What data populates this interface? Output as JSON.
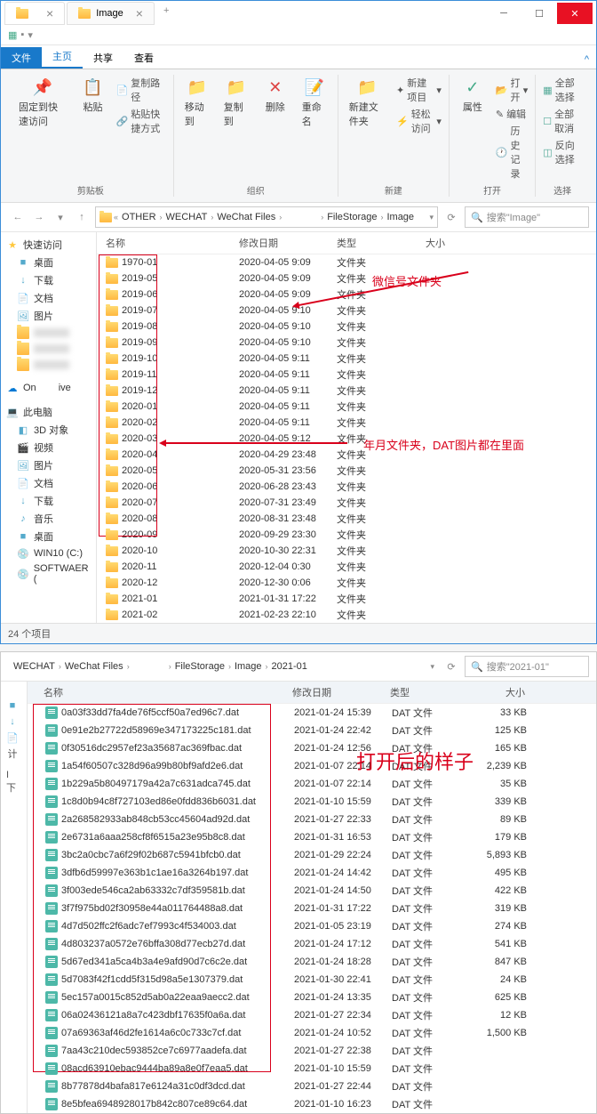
{
  "window1": {
    "tab_label": "Image",
    "ribbon_tabs": {
      "file": "文件",
      "home": "主页",
      "share": "共享",
      "view": "查看"
    },
    "ribbon": {
      "pin_label": "固定到快速访问",
      "paste": "粘贴",
      "copy_path": "复制路径",
      "paste_shortcut": "粘贴快捷方式",
      "clipboard": "剪贴板",
      "move_to": "移动到",
      "copy_to": "复制到",
      "delete": "删除",
      "rename": "重命名",
      "organize": "组织",
      "new_folder": "新建文件夹",
      "new_item": "新建项目",
      "easy_access": "轻松访问",
      "new": "新建",
      "properties": "属性",
      "open": "打开",
      "edit": "编辑",
      "history": "历史记录",
      "open_group": "打开",
      "select_all": "全部选择",
      "select_none": "全部取消",
      "invert": "反向选择",
      "select": "选择"
    },
    "breadcrumb": [
      "OTHER",
      "WECHAT",
      "WeChat Files",
      "",
      "FileStorage",
      "Image"
    ],
    "search_placeholder": "搜索\"Image\"",
    "columns": {
      "name": "名称",
      "date": "修改日期",
      "type": "类型",
      "size": "大小"
    },
    "sidebar": {
      "quick": "快速访问",
      "desktop": "桌面",
      "downloads": "下载",
      "documents": "文档",
      "pictures": "图片",
      "onedrive": "On",
      "thispc": "此电脑",
      "3d": "3D 对象",
      "videos": "视频",
      "pictures2": "图片",
      "documents2": "文档",
      "downloads2": "下载",
      "music": "音乐",
      "desktop2": "桌面",
      "win10": "WIN10 (C:)",
      "softwaer": "SOFTWAER (",
      "ive": "ive"
    },
    "folders": [
      {
        "n": "1970-01",
        "d": "2020-04-05 9:09",
        "t": "文件夹"
      },
      {
        "n": "2019-05",
        "d": "2020-04-05 9:09",
        "t": "文件夹"
      },
      {
        "n": "2019-06",
        "d": "2020-04-05 9:09",
        "t": "文件夹"
      },
      {
        "n": "2019-07",
        "d": "2020-04-05 9:10",
        "t": "文件夹"
      },
      {
        "n": "2019-08",
        "d": "2020-04-05 9:10",
        "t": "文件夹"
      },
      {
        "n": "2019-09",
        "d": "2020-04-05 9:10",
        "t": "文件夹"
      },
      {
        "n": "2019-10",
        "d": "2020-04-05 9:11",
        "t": "文件夹"
      },
      {
        "n": "2019-11",
        "d": "2020-04-05 9:11",
        "t": "文件夹"
      },
      {
        "n": "2019-12",
        "d": "2020-04-05 9:11",
        "t": "文件夹"
      },
      {
        "n": "2020-01",
        "d": "2020-04-05 9:11",
        "t": "文件夹"
      },
      {
        "n": "2020-02",
        "d": "2020-04-05 9:11",
        "t": "文件夹"
      },
      {
        "n": "2020-03",
        "d": "2020-04-05 9:12",
        "t": "文件夹"
      },
      {
        "n": "2020-04",
        "d": "2020-04-29 23:48",
        "t": "文件夹"
      },
      {
        "n": "2020-05",
        "d": "2020-05-31 23:56",
        "t": "文件夹"
      },
      {
        "n": "2020-06",
        "d": "2020-06-28 23:43",
        "t": "文件夹"
      },
      {
        "n": "2020-07",
        "d": "2020-07-31 23:49",
        "t": "文件夹"
      },
      {
        "n": "2020-08",
        "d": "2020-08-31 23:48",
        "t": "文件夹"
      },
      {
        "n": "2020-09",
        "d": "2020-09-29 23:30",
        "t": "文件夹"
      },
      {
        "n": "2020-10",
        "d": "2020-10-30 22:31",
        "t": "文件夹"
      },
      {
        "n": "2020-11",
        "d": "2020-12-04 0:30",
        "t": "文件夹"
      },
      {
        "n": "2020-12",
        "d": "2020-12-30 0:06",
        "t": "文件夹"
      },
      {
        "n": "2021-01",
        "d": "2021-01-31 17:22",
        "t": "文件夹"
      },
      {
        "n": "2021-02",
        "d": "2021-02-23 22:10",
        "t": "文件夹"
      }
    ],
    "status": "24 个项目",
    "annotation1": "微信号文件夹",
    "annotation2": "年月文件夹，DAT图片都在里面"
  },
  "window2": {
    "breadcrumb": [
      "WECHAT",
      "WeChat Files",
      "",
      "FileStorage",
      "Image",
      "2021-01"
    ],
    "search_placeholder": "搜索\"2021-01\"",
    "columns": {
      "name": "名称",
      "date": "修改日期",
      "type": "类型",
      "size": "大小"
    },
    "annotation": "打开后的样子",
    "files": [
      {
        "n": "0a03f33dd7fa4de76f5ccf50a7ed96c7.dat",
        "d": "2021-01-24 15:39",
        "t": "DAT 文件",
        "s": "33 KB"
      },
      {
        "n": "0e91e2b27722d58969e347173225c181.dat",
        "d": "2021-01-24 22:42",
        "t": "DAT 文件",
        "s": "125 KB"
      },
      {
        "n": "0f30516dc2957ef23a35687ac369fbac.dat",
        "d": "2021-01-24 12:56",
        "t": "DAT 文件",
        "s": "165 KB"
      },
      {
        "n": "1a54f60507c328d96a99b80bf9afd2e6.dat",
        "d": "2021-01-07 22:14",
        "t": "DAT 文件",
        "s": "2,239 KB"
      },
      {
        "n": "1b229a5b80497179a42a7c631adca745.dat",
        "d": "2021-01-07 22:14",
        "t": "DAT 文件",
        "s": "35 KB"
      },
      {
        "n": "1c8d0b94c8f727103ed86e0fdd836b6031.dat",
        "d": "2021-01-10 15:59",
        "t": "DAT 文件",
        "s": "339 KB"
      },
      {
        "n": "2a268582933ab848cb53cc45604ad92d.dat",
        "d": "2021-01-27 22:33",
        "t": "DAT 文件",
        "s": "89 KB"
      },
      {
        "n": "2e6731a6aaa258cf8f6515a23e95b8c8.dat",
        "d": "2021-01-31 16:53",
        "t": "DAT 文件",
        "s": "179 KB"
      },
      {
        "n": "3bc2a0cbc7a6f29f02b687c5941bfcb0.dat",
        "d": "2021-01-29 22:24",
        "t": "DAT 文件",
        "s": "5,893 KB"
      },
      {
        "n": "3dfb6d59997e363b1c1ae16a3264b197.dat",
        "d": "2021-01-24 14:42",
        "t": "DAT 文件",
        "s": "495 KB"
      },
      {
        "n": "3f003ede546ca2ab63332c7df359581b.dat",
        "d": "2021-01-24 14:50",
        "t": "DAT 文件",
        "s": "422 KB"
      },
      {
        "n": "3f7f975bd02f30958e44a011764488a8.dat",
        "d": "2021-01-31 17:22",
        "t": "DAT 文件",
        "s": "319 KB"
      },
      {
        "n": "4d7d502ffc2f6adc7ef7993c4f534003.dat",
        "d": "2021-01-05 23:19",
        "t": "DAT 文件",
        "s": "274 KB"
      },
      {
        "n": "4d803237a0572e76bffa308d77ecb27d.dat",
        "d": "2021-01-24 17:12",
        "t": "DAT 文件",
        "s": "541 KB"
      },
      {
        "n": "5d67ed341a5ca4b3a4e9afd90d7c6c2e.dat",
        "d": "2021-01-24 18:28",
        "t": "DAT 文件",
        "s": "847 KB"
      },
      {
        "n": "5d7083f42f1cdd5f315d98a5e1307379.dat",
        "d": "2021-01-30 22:41",
        "t": "DAT 文件",
        "s": "24 KB"
      },
      {
        "n": "5ec157a0015c852d5ab0a22eaa9aecc2.dat",
        "d": "2021-01-24 13:35",
        "t": "DAT 文件",
        "s": "625 KB"
      },
      {
        "n": "06a02436121a8a7c423dbf17635f0a6a.dat",
        "d": "2021-01-27 22:34",
        "t": "DAT 文件",
        "s": "12 KB"
      },
      {
        "n": "07a69363af46d2fe1614a6c0c733c7cf.dat",
        "d": "2021-01-24 10:52",
        "t": "DAT 文件",
        "s": "1,500 KB"
      },
      {
        "n": "7aa43c210dec593852ce7c6977aadefa.dat",
        "d": "2021-01-27 22:38",
        "t": "DAT 文件",
        "s": ""
      },
      {
        "n": "08acd63910ebac9444ba89a8e0f7eaa5.dat",
        "d": "2021-01-10 15:59",
        "t": "DAT 文件",
        "s": ""
      },
      {
        "n": "8b77878d4bafa817e6124a31c0df3dcd.dat",
        "d": "2021-01-27 22:44",
        "t": "DAT 文件",
        "s": ""
      },
      {
        "n": "8e5bfea6948928017b842c807ce89c64.dat",
        "d": "2021-01-10 16:23",
        "t": "DAT 文件",
        "s": ""
      }
    ]
  }
}
